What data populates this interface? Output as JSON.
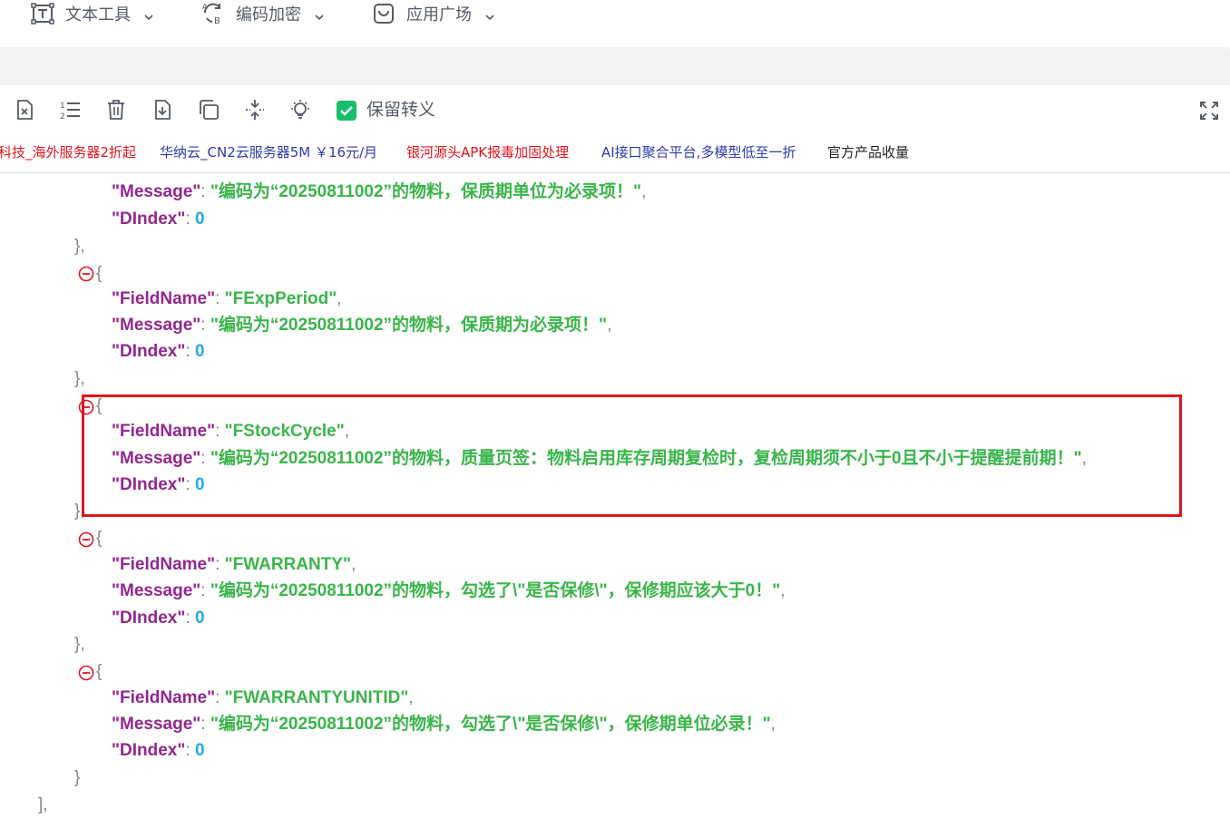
{
  "nav": {
    "items": [
      {
        "label": "文本工具",
        "icon": "text-tool-icon"
      },
      {
        "label": "编码加密",
        "icon": "encode-refresh-icon"
      },
      {
        "label": "应用广场",
        "icon": "app-store-icon"
      }
    ]
  },
  "toolbar": {
    "buttons": [
      {
        "name": "clear-file-button",
        "icon": "file-x-icon"
      },
      {
        "name": "line-numbers-button",
        "icon": "ordered-list-icon"
      },
      {
        "name": "delete-button",
        "icon": "trash-icon"
      },
      {
        "name": "download-button",
        "icon": "file-download-icon"
      },
      {
        "name": "copy-button",
        "icon": "copy-icon"
      },
      {
        "name": "compress-button",
        "icon": "compress-icon"
      },
      {
        "name": "theme-button",
        "icon": "lightbulb-icon"
      }
    ],
    "keep_escape_label": "保留转义",
    "keep_escape_checked": true,
    "fullscreen_icon": "fullscreen-icon",
    "accent_color": "#19be6b"
  },
  "ads": [
    {
      "text": "科技_海外服务器2折起",
      "color": "#e0141e"
    },
    {
      "text": "华纳云_CN2云服务器5M ￥16元/月",
      "color": "#2d3aa8"
    },
    {
      "text": "银河源头APK报毒加固处理",
      "color": "#e0141e"
    },
    {
      "text": "AI接口聚合平台,多模型低至一折",
      "color": "#2d3aa8"
    },
    {
      "text": "官方产品收量",
      "color": "#222222"
    }
  ],
  "json_view": {
    "colors": {
      "key": "#92278f",
      "string": "#3ab54a",
      "number": "#25aae2",
      "highlight": "#e0141e"
    },
    "top_partial": {
      "message_key": "\"Message\"",
      "message_value": "\"编码为“20250811002”的物料，保质期单位为必录项！\"",
      "dindex_key": "\"DIndex\"",
      "dindex_value": "0"
    },
    "objects": [
      {
        "fieldname_key": "\"FieldName\"",
        "fieldname_value": "\"FExpPeriod\"",
        "message_key": "\"Message\"",
        "message_value": "\"编码为“20250811002”的物料，保质期为必录项！\"",
        "dindex_key": "\"DIndex\"",
        "dindex_value": "0"
      },
      {
        "fieldname_key": "\"FieldName\"",
        "fieldname_value": "\"FStockCycle\"",
        "message_key": "\"Message\"",
        "message_value": "\"编码为“20250811002”的物料，质量页签：物料启用库存周期复检时，复检周期须不小于0且不小于提醒提前期！\"",
        "dindex_key": "\"DIndex\"",
        "dindex_value": "0"
      },
      {
        "fieldname_key": "\"FieldName\"",
        "fieldname_value": "\"FWARRANTY\"",
        "message_key": "\"Message\"",
        "message_value": "\"编码为“20250811002”的物料，勾选了\\\"是否保修\\\"，保修期应该大于0！\"",
        "dindex_key": "\"DIndex\"",
        "dindex_value": "0"
      },
      {
        "fieldname_key": "\"FieldName\"",
        "fieldname_value": "\"FWARRANTYUNITID\"",
        "message_key": "\"Message\"",
        "message_value": "\"编码为“20250811002”的物料，勾选了\\\"是否保修\\\"，保修期单位必录！\"",
        "dindex_key": "\"DIndex\"",
        "dindex_value": "0"
      }
    ],
    "punct": {
      "colon": ": ",
      "comma": ",",
      "open_brace": "{",
      "close_brace": "}",
      "close_brace_comma": "},",
      "close_bracket_comma": "],"
    },
    "collapse_icon": "collapse-minus-icon"
  }
}
